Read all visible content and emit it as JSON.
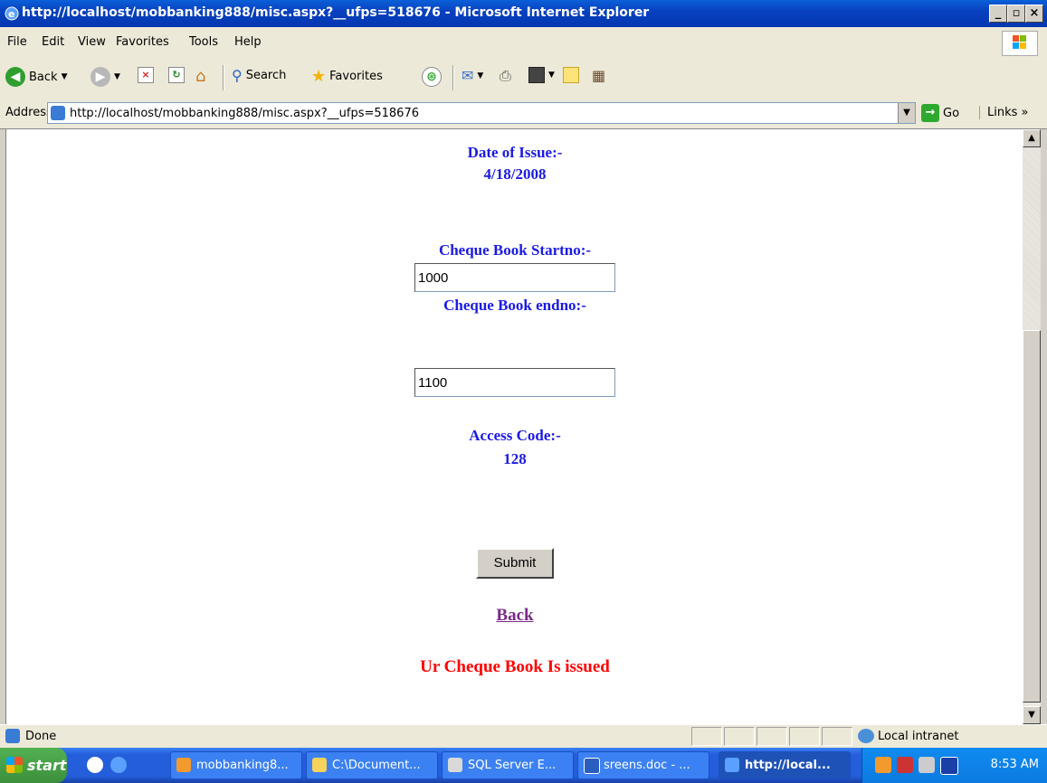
{
  "window": {
    "title": "http://localhost/mobbanking888/misc.aspx?__ufps=518676 - Microsoft Internet Explorer"
  },
  "menu": [
    "File",
    "Edit",
    "View",
    "Favorites",
    "Tools",
    "Help"
  ],
  "toolbar": {
    "back": "Back",
    "search": "Search",
    "favorites": "Favorites"
  },
  "address": {
    "label": "Address",
    "url": "http://localhost/mobbanking888/misc.aspx?__ufps=518676",
    "go": "Go",
    "links": "Links"
  },
  "form": {
    "date_label": "Date of Issue:-",
    "date_value": "4/18/2008",
    "start_label": "Cheque Book Startno:-",
    "start_value": "1000",
    "end_label": "Cheque Book endno:-",
    "end_value": "1100",
    "access_label": "Access Code:-",
    "access_value": "128",
    "submit": "Submit",
    "back": "Back",
    "message": "Ur Cheque Book Is issued"
  },
  "status": {
    "text": "Done",
    "zone": "Local intranet"
  },
  "taskbar": {
    "start": "start",
    "tasks": [
      "mobbanking8...",
      "C:\\Document...",
      "SQL Server E...",
      "sreens.doc - ...",
      "http://local..."
    ],
    "clock": "8:53 AM"
  },
  "colors": {
    "label_blue": "#1a1ae6",
    "message_red": "#ff0000",
    "link_purple": "#7a2a8a"
  }
}
